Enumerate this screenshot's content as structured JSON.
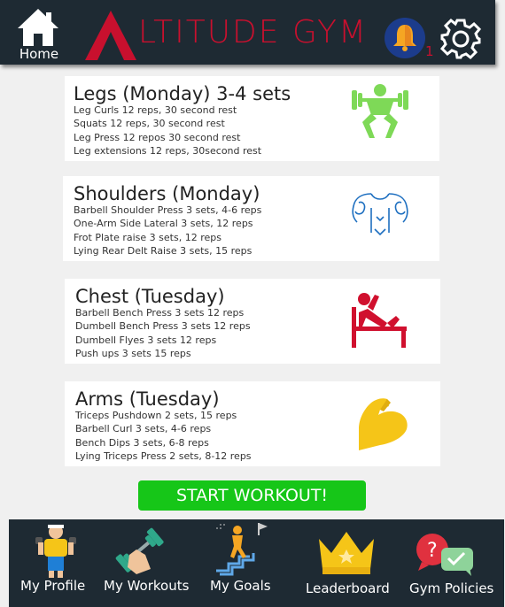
{
  "header": {
    "home_label": "Home",
    "logo_text": "LTITUDE GYM",
    "notification_count": "1"
  },
  "workouts": [
    {
      "title": "Legs (Monday) 3-4 sets",
      "exercises": [
        "Leg Curls 12 reps, 30 second rest",
        "Squats 12 reps, 30 second rest",
        "Leg Press 12 repos 30 second rest",
        "Leg extensions 12 reps, 30second rest"
      ],
      "icon": "squat-icon",
      "icon_color": "#7ed957"
    },
    {
      "title": "Shoulders (Monday)",
      "exercises": [
        "Barbell Shoulder Press 3 sets, 4-6 reps",
        "One-Arm Side Lateral 3 sets, 12 reps",
        "Frot Plate raise 3 sets, 12 reps",
        "Lying Rear Delt Raise 3 sets, 15 reps"
      ],
      "icon": "shoulders-icon",
      "icon_color": "#1e6fc0"
    },
    {
      "title": "Chest (Tuesday)",
      "exercises": [
        "Barbell Bench Press 3 sets 12 reps",
        "Dumbell Bench Press 3 sets 12 reps",
        "Dumbell Flyes 3 sets 12 reps",
        "Push ups 3 sets 15 reps"
      ],
      "icon": "bench-press-icon",
      "icon_color": "#d0102e"
    },
    {
      "title": "Arms (Tuesday)",
      "exercises": [
        "Triceps Pushdown 2 sets, 15 reps",
        "Barbell Curl 3 sets, 4-6 reps",
        "Bench Dips 3 sets, 6-8 reps",
        "Lying Triceps Press 2 sets, 8-12 reps"
      ],
      "icon": "flexed-arm-icon",
      "icon_color": "#f5c518"
    }
  ],
  "start_button_label": "START WORKOUT!",
  "bottom_nav": [
    {
      "label": "My Profile",
      "icon": "profile-icon"
    },
    {
      "label": "My Workouts",
      "icon": "workouts-icon"
    },
    {
      "label": "My Goals",
      "icon": "goals-icon"
    },
    {
      "label": "Leaderboard",
      "icon": "crown-icon"
    },
    {
      "label": "Gym Policies",
      "icon": "policies-icon"
    }
  ],
  "colors": {
    "bar_background": "#1e2a33",
    "brand_red": "#c8102e",
    "start_green": "#16c618",
    "page_background": "#f0f0f0"
  }
}
